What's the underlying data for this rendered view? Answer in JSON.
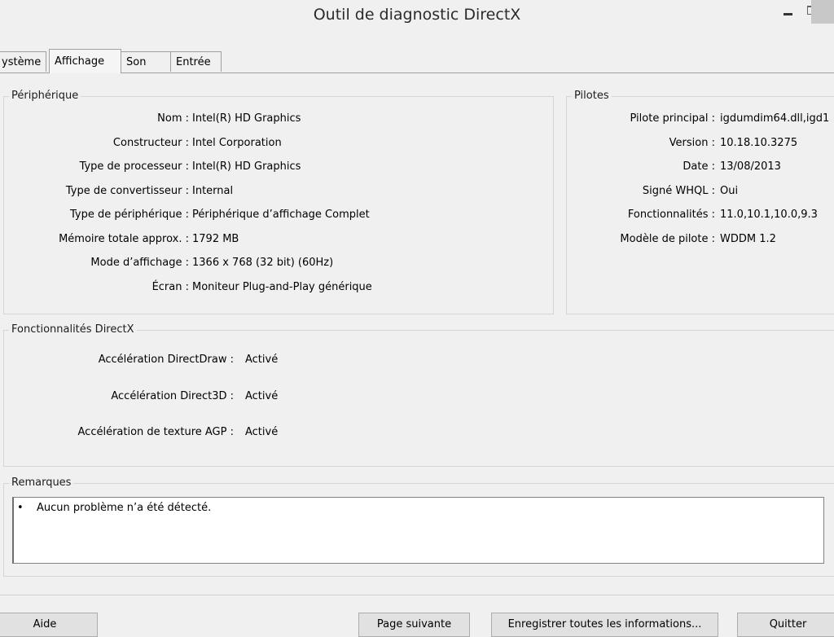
{
  "window": {
    "title": "Outil de diagnostic DirectX"
  },
  "tabs": [
    "ystème",
    "Affichage",
    "Son",
    "Entrée"
  ],
  "peripherique": {
    "legend": "Périphérique",
    "rows": [
      {
        "label": "Nom :",
        "value": "Intel(R) HD Graphics"
      },
      {
        "label": "Constructeur :",
        "value": "Intel Corporation"
      },
      {
        "label": "Type de processeur :",
        "value": "Intel(R) HD Graphics"
      },
      {
        "label": "Type de convertisseur :",
        "value": "Internal"
      },
      {
        "label": "Type de périphérique :",
        "value": "Périphérique d’affichage Complet"
      },
      {
        "label": "Mémoire totale approx. :",
        "value": "1792 MB"
      },
      {
        "label": "Mode d’affichage :",
        "value": "1366 x 768 (32 bit) (60Hz)"
      },
      {
        "label": "Écran :",
        "value": "Moniteur Plug-and-Play générique"
      }
    ]
  },
  "pilotes": {
    "legend": "Pilotes",
    "rows": [
      {
        "label": "Pilote principal :",
        "value": "igdumdim64.dll,igd1"
      },
      {
        "label": "Version :",
        "value": "10.18.10.3275"
      },
      {
        "label": "Date :",
        "value": "13/08/2013"
      },
      {
        "label": "Signé WHQL :",
        "value": "Oui"
      },
      {
        "label": "Fonctionnalités :",
        "value": "11.0,10.1,10.0,9.3"
      },
      {
        "label": "Modèle de pilote :",
        "value": "WDDM 1.2"
      }
    ]
  },
  "directx": {
    "legend": "Fonctionnalités DirectX",
    "rows": [
      {
        "label": "Accélération DirectDraw :",
        "value": "Activé"
      },
      {
        "label": "Accélération Direct3D :",
        "value": "Activé"
      },
      {
        "label": "Accélération de texture AGP :",
        "value": "Activé"
      }
    ]
  },
  "remarques": {
    "legend": "Remarques",
    "bullet": "•",
    "text": "Aucun problème n’a été détecté."
  },
  "buttons": {
    "aide": "Aide",
    "page_suivante": "Page suivante",
    "enregistrer": "Enregistrer toutes les informations...",
    "quitter": "Quitter"
  }
}
